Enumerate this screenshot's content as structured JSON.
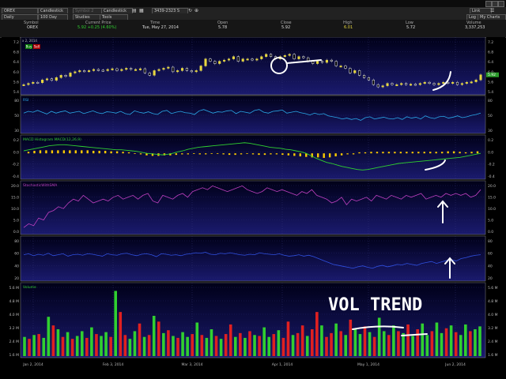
{
  "toolbar": {
    "symbol": "OREX",
    "chart_type_1": "Candlestick",
    "symbol2_placeholder": "Symbol 2",
    "chart_type_2": "Candlestick",
    "period_code": "3439-2323 S",
    "right_combo": "Link",
    "period": "Daily",
    "range": "100 Day",
    "studies": "Studies",
    "tools": "Tools",
    "log": "Log",
    "my_charts": "My Charts"
  },
  "quote": {
    "headers": [
      "Symbol",
      "Current Price",
      "Time",
      "Open",
      "Close",
      "High",
      "Low",
      "Volume"
    ],
    "values": [
      "OREX",
      "5.92 +0.25 (4.60%)",
      "Tue, May 27, 2014",
      "5.78",
      "5.92",
      "6.01",
      "5.72",
      "3,337,253"
    ]
  },
  "colors": {
    "bg": "#0a0a3a",
    "up": "#e8d840",
    "down": "#ffffff",
    "rsi": "#2aa8e8",
    "macd": "#30d030",
    "hist": "#ffcc00",
    "stoch": "#c040c0",
    "blue": "#3050e0",
    "vol_up": "#30d030",
    "vol_down": "#e02020"
  },
  "chart_data": [
    {
      "type": "candlestick",
      "title": "",
      "ylabels": [
        "7.2",
        "6.8",
        "6.4",
        "6.0",
        "5.6",
        "5.4"
      ],
      "top_label": "x 2, 2014",
      "buttons": [
        "Buy",
        "Sell"
      ],
      "current_price_tag": "5.92",
      "x_labels": [
        "Jan 2, 2014",
        "Feb 3, 2014",
        "Mar 3, 2014",
        "Apr 1, 2014",
        "May 1, 2014",
        "Jun 2, 2014"
      ],
      "close": [
        5.5,
        5.55,
        5.6,
        5.58,
        5.7,
        5.75,
        5.68,
        5.8,
        5.9,
        5.85,
        6.0,
        6.05,
        6.1,
        6.08,
        6.1,
        6.15,
        6.12,
        6.1,
        6.15,
        6.18,
        6.1,
        6.15,
        6.2,
        6.15,
        6.15,
        6.18,
        6.0,
        5.9,
        6.1,
        6.15,
        6.2,
        6.25,
        6.05,
        6.1,
        6.2,
        6.1,
        6.05,
        6.1,
        6.3,
        6.6,
        6.5,
        6.4,
        6.5,
        6.55,
        6.6,
        6.7,
        6.5,
        6.6,
        6.6,
        6.55,
        6.6,
        6.7,
        6.8,
        6.7,
        6.6,
        6.7,
        6.75,
        6.8,
        6.6,
        6.7,
        6.65,
        6.5,
        6.4,
        6.5,
        6.45,
        6.55,
        6.5,
        6.3,
        6.3,
        6.2,
        6.0,
        6.1,
        5.9,
        5.8,
        5.7,
        5.5,
        5.4,
        5.45,
        5.55,
        5.5,
        5.5,
        5.55,
        5.5,
        5.52,
        5.5,
        5.55,
        5.6,
        5.55,
        5.5,
        5.55,
        5.6,
        5.55,
        5.6,
        5.5,
        5.55,
        5.6,
        5.62,
        5.7,
        5.92
      ]
    },
    {
      "type": "line",
      "title": "RSI",
      "ylabels": [
        "80",
        "50",
        "30"
      ],
      "series": [
        {
          "name": "",
          "values": [
            58,
            62,
            60,
            64,
            60,
            56,
            62,
            58,
            61,
            63,
            58,
            60,
            62,
            57,
            60,
            63,
            59,
            57,
            61,
            60,
            58,
            62,
            57,
            55,
            63,
            60,
            58,
            61,
            57,
            55,
            62,
            64,
            57,
            60,
            62,
            59,
            58,
            55,
            63,
            66,
            62,
            58,
            61,
            60,
            63,
            64,
            57,
            62,
            60,
            58,
            64,
            66,
            60,
            58,
            62,
            63,
            65,
            58,
            60,
            62,
            59,
            57,
            54,
            58,
            55,
            57,
            52,
            50,
            48,
            45,
            47,
            44,
            46,
            42,
            48,
            50,
            45,
            47,
            49,
            46,
            45,
            48,
            44,
            50,
            47,
            49,
            45,
            52,
            48,
            46,
            50,
            51,
            47,
            49,
            52,
            48,
            50,
            53,
            55,
            58
          ]
        }
      ]
    },
    {
      "type": "bar",
      "title": "MACD Histogram  MACD(12,26,9)",
      "ylabels": [
        "0.2",
        "0.0",
        "-0.2",
        "-0.4"
      ],
      "series": [
        {
          "name": "MACD",
          "values": [
            0.05,
            0.07,
            0.09,
            0.11,
            0.13,
            0.15,
            0.16,
            0.17,
            0.17,
            0.16,
            0.15,
            0.14,
            0.13,
            0.12,
            0.11,
            0.1,
            0.09,
            0.08,
            0.07,
            0.07,
            0.06,
            0.05,
            0.04,
            0.02,
            0.0,
            -0.01,
            -0.02,
            -0.03,
            -0.02,
            0.0,
            0.03,
            0.05,
            0.08,
            0.1,
            0.12,
            0.13,
            0.14,
            0.15,
            0.16,
            0.17,
            0.18,
            0.19,
            0.2,
            0.21,
            0.2,
            0.18,
            0.16,
            0.14,
            0.12,
            0.11,
            0.1,
            0.08,
            0.07,
            0.05,
            0.03,
            0.0,
            -0.05,
            -0.1,
            -0.14,
            -0.18,
            -0.2,
            -0.23,
            -0.26,
            -0.28,
            -0.3,
            -0.32,
            -0.33,
            -0.32,
            -0.3,
            -0.28,
            -0.26,
            -0.24,
            -0.22,
            -0.2,
            -0.19,
            -0.18,
            -0.17,
            -0.16,
            -0.15,
            -0.14,
            -0.13,
            -0.12,
            -0.11,
            -0.1,
            -0.09,
            -0.08,
            -0.06,
            -0.04,
            -0.02,
            0.0
          ]
        },
        {
          "name": "MACD Histogram",
          "values": [
            0.03,
            0.05,
            0.06,
            0.06,
            0.06,
            0.06,
            0.06,
            0.06,
            0.06,
            0.06,
            0.06,
            0.05,
            0.05,
            0.05,
            0.04,
            0.04,
            0.03,
            0.02,
            0.0,
            -0.02,
            -0.04,
            -0.05,
            -0.05,
            -0.04,
            -0.04,
            -0.03,
            -0.02,
            -0.02,
            -0.01,
            -0.02,
            -0.02,
            -0.01,
            -0.01,
            -0.02,
            -0.03,
            -0.03,
            -0.02,
            -0.01,
            -0.02,
            -0.03,
            -0.03,
            -0.02,
            -0.02,
            -0.03,
            -0.04,
            -0.05,
            -0.06,
            -0.07,
            -0.08,
            -0.08,
            -0.09,
            -0.08,
            -0.06,
            -0.04,
            -0.02,
            -0.02,
            0.02,
            0.02,
            0.03,
            0.03,
            0.03,
            0.03,
            0.03,
            0.03,
            0.03,
            0.03,
            0.03,
            0.03,
            0.03,
            0.03,
            0.03,
            0.04,
            0.04,
            0.03,
            0.02,
            0.03,
            0.04
          ]
        }
      ]
    },
    {
      "type": "line",
      "title": "StochasticWithSMA",
      "ylabels": [
        "20.0",
        "15.0",
        "10.0",
        "5.0",
        "0.0"
      ],
      "series": [
        {
          "name": "",
          "values": [
            1,
            3,
            2,
            6,
            5,
            9,
            10,
            12,
            11,
            14,
            16,
            15,
            18,
            16,
            14,
            15,
            16,
            15,
            17,
            18,
            16,
            17,
            18,
            16,
            18,
            19,
            15,
            14,
            18,
            17,
            16,
            18,
            19,
            17,
            20,
            21,
            22,
            21,
            23,
            22,
            21,
            20,
            21,
            22,
            23,
            21,
            20,
            19,
            20,
            22,
            21,
            20,
            21,
            20,
            19,
            18,
            20,
            19,
            21,
            18,
            17,
            16,
            14,
            15,
            17,
            13,
            16,
            15,
            16,
            17,
            15,
            18,
            17,
            16,
            18,
            17,
            16,
            18,
            17,
            18,
            19,
            16,
            17,
            18,
            17,
            19,
            18,
            19,
            18,
            19,
            17,
            18,
            21
          ]
        }
      ]
    },
    {
      "type": "line",
      "title": "",
      "ylabels": [
        "80",
        "60",
        "40",
        "20"
      ],
      "series": [
        {
          "name": "",
          "values": [
            58,
            60,
            56,
            59,
            57,
            61,
            56,
            58,
            60,
            55,
            58,
            59,
            57,
            60,
            59,
            57,
            55,
            60,
            58,
            57,
            60,
            61,
            58,
            56,
            59,
            60,
            58,
            54,
            60,
            59,
            57,
            58,
            56,
            59,
            60,
            62,
            61,
            63,
            59,
            58,
            61,
            60,
            62,
            60,
            58,
            57,
            59,
            58,
            62,
            60,
            59,
            58,
            60,
            57,
            55,
            56,
            58,
            55,
            57,
            54,
            50,
            46,
            42,
            38,
            36,
            34,
            32,
            30,
            33,
            35,
            32,
            30,
            34,
            36,
            33,
            35,
            38,
            37,
            40,
            38,
            36,
            40,
            42,
            44,
            40,
            43,
            46,
            48,
            45,
            50,
            52,
            55,
            57,
            58
          ]
        }
      ]
    },
    {
      "type": "bar",
      "title": "Volume",
      "ylabels": [
        "5.6 M",
        "4.8 M",
        "4.0 M",
        "3.2 M",
        "2.4 M",
        "1.6 M"
      ],
      "values": [
        2.0,
        1.8,
        2.2,
        2.3,
        1.9,
        4.1,
        3.2,
        2.8,
        2.0,
        2.5,
        1.8,
        2.1,
        2.6,
        1.9,
        3.0,
        2.3,
        2.1,
        2.5,
        2.0,
        6.8,
        4.6,
        2.2,
        1.8,
        2.6,
        3.4,
        2.0,
        2.2,
        4.2,
        3.6,
        2.4,
        2.7,
        2.1,
        1.9,
        2.5,
        2.0,
        2.3,
        3.5,
        2.2,
        1.9,
        2.8,
        2.1,
        1.8,
        2.3,
        3.3,
        2.0,
        2.4,
        1.9,
        2.6,
        2.2,
        2.1,
        3.0,
        2.0,
        2.3,
        2.7,
        1.9,
        3.6,
        2.2,
        2.4,
        3.2,
        2.1,
        2.8,
        4.6,
        3.2,
        2.0,
        2.4,
        3.4,
        2.6,
        2.2,
        3.8,
        2.8,
        2.3,
        3.1,
        2.5,
        2.0,
        4.0,
        2.6,
        2.2,
        3.2,
        2.6,
        2.4,
        3.3,
        2.1,
        2.8,
        3.4,
        2.2,
        2.6,
        3.5,
        2.4,
        2.9,
        3.2,
        2.5,
        2.2,
        3.3,
        2.6,
        2.8,
        3.1
      ],
      "colors_up": [
        1,
        0,
        1,
        0,
        1,
        1,
        0,
        1,
        0,
        1,
        0,
        1,
        1,
        0,
        1,
        0,
        1,
        1,
        0,
        1,
        0,
        0,
        1,
        1,
        0,
        1,
        0,
        1,
        0,
        1,
        0,
        1,
        0,
        1,
        1,
        0,
        1,
        0,
        1,
        1,
        0,
        1,
        0,
        0,
        1,
        0,
        1,
        0,
        1,
        0,
        1,
        1,
        0,
        1,
        0,
        0,
        1,
        0,
        0,
        1,
        0,
        0,
        1,
        0,
        0,
        1,
        0,
        1,
        0,
        1,
        1,
        0,
        1,
        0,
        1,
        1,
        0,
        1,
        0,
        1,
        0,
        1,
        0,
        1,
        1,
        0,
        1,
        1,
        0,
        1,
        0,
        1,
        1,
        0,
        1,
        1
      ]
    }
  ],
  "annotations": {
    "handwritten": "VOL TREND"
  }
}
